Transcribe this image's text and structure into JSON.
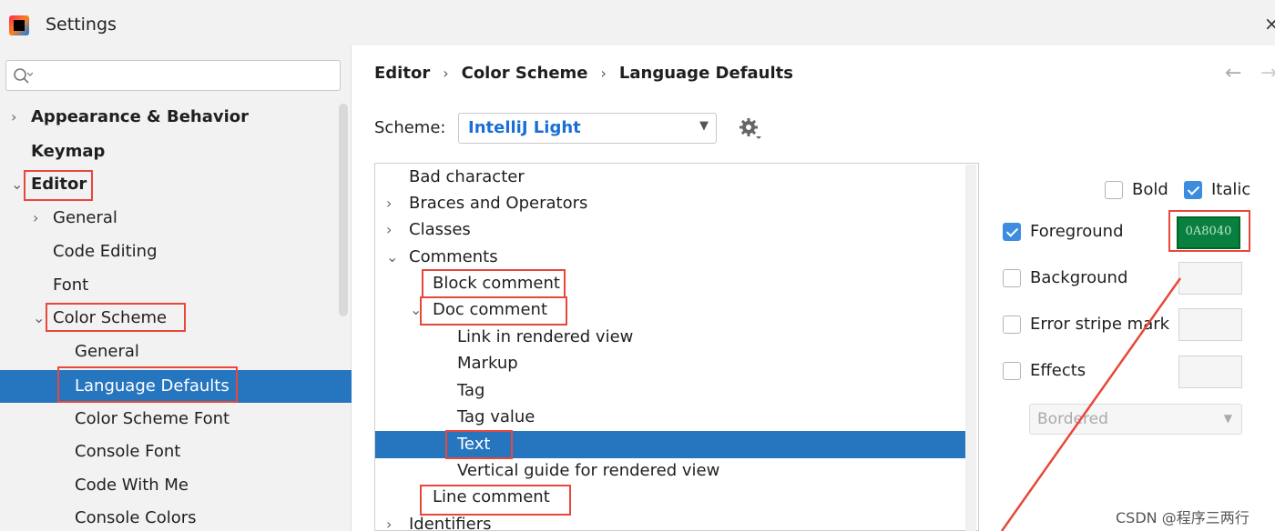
{
  "window": {
    "title": "Settings",
    "close": "×"
  },
  "search": {
    "placeholder": ""
  },
  "tree": [
    {
      "label": "Appearance & Behavior",
      "chevron": "›",
      "bold": true
    },
    {
      "label": "Keymap",
      "chevron": "",
      "bold": true
    },
    {
      "label": "Editor",
      "chevron": "⌄",
      "bold": true
    },
    {
      "label": "General",
      "chevron": "›",
      "bold": false
    },
    {
      "label": "Code Editing",
      "chevron": "",
      "bold": false
    },
    {
      "label": "Font",
      "chevron": "",
      "bold": false
    },
    {
      "label": "Color Scheme",
      "chevron": "⌄",
      "bold": false
    },
    {
      "label": "General",
      "chevron": "",
      "bold": false
    },
    {
      "label": "Language Defaults",
      "chevron": "",
      "bold": false,
      "selected": true
    },
    {
      "label": "Color Scheme Font",
      "chevron": "",
      "bold": false
    },
    {
      "label": "Console Font",
      "chevron": "",
      "bold": false
    },
    {
      "label": "Code With Me",
      "chevron": "",
      "bold": false
    },
    {
      "label": "Console Colors",
      "chevron": "",
      "bold": false
    }
  ],
  "breadcrumb": {
    "a": "Editor",
    "b": "Color Scheme",
    "c": "Language Defaults",
    "sep": "›",
    "back": "←",
    "forward": "→"
  },
  "scheme": {
    "label": "Scheme:",
    "value": "IntelliJ Light",
    "dropdown": "▼"
  },
  "elements": [
    {
      "label": "Bad character",
      "chevron": ""
    },
    {
      "label": "Braces and Operators",
      "chevron": "›"
    },
    {
      "label": "Classes",
      "chevron": "›"
    },
    {
      "label": "Comments",
      "chevron": "⌄"
    },
    {
      "label": "Block comment",
      "chevron": ""
    },
    {
      "label": "Doc comment",
      "chevron": "⌄"
    },
    {
      "label": "Link in rendered view",
      "chevron": ""
    },
    {
      "label": "Markup",
      "chevron": ""
    },
    {
      "label": "Tag",
      "chevron": ""
    },
    {
      "label": "Tag value",
      "chevron": ""
    },
    {
      "label": "Text",
      "chevron": "",
      "selected": true
    },
    {
      "label": "Vertical guide for rendered view",
      "chevron": ""
    },
    {
      "label": "Line comment",
      "chevron": ""
    },
    {
      "label": "Identifiers",
      "chevron": "›"
    }
  ],
  "attributes": {
    "bold": {
      "label": "Bold",
      "checked": false
    },
    "italic": {
      "label": "Italic",
      "checked": true
    },
    "foreground": {
      "label": "Foreground",
      "checked": true,
      "value": "0A8040",
      "color": "#0a8040"
    },
    "background": {
      "label": "Background",
      "checked": false
    },
    "error_stripe": {
      "label": "Error stripe mark",
      "checked": false
    },
    "effects": {
      "label": "Effects",
      "checked": false
    },
    "effect_type": {
      "value": "Bordered",
      "dropdown": "▼"
    }
  },
  "colors": {
    "selection": "#2675bf",
    "accent": "#3d8ce0",
    "annotation": "#e8473a"
  },
  "watermark": "CSDN @程序三两行"
}
